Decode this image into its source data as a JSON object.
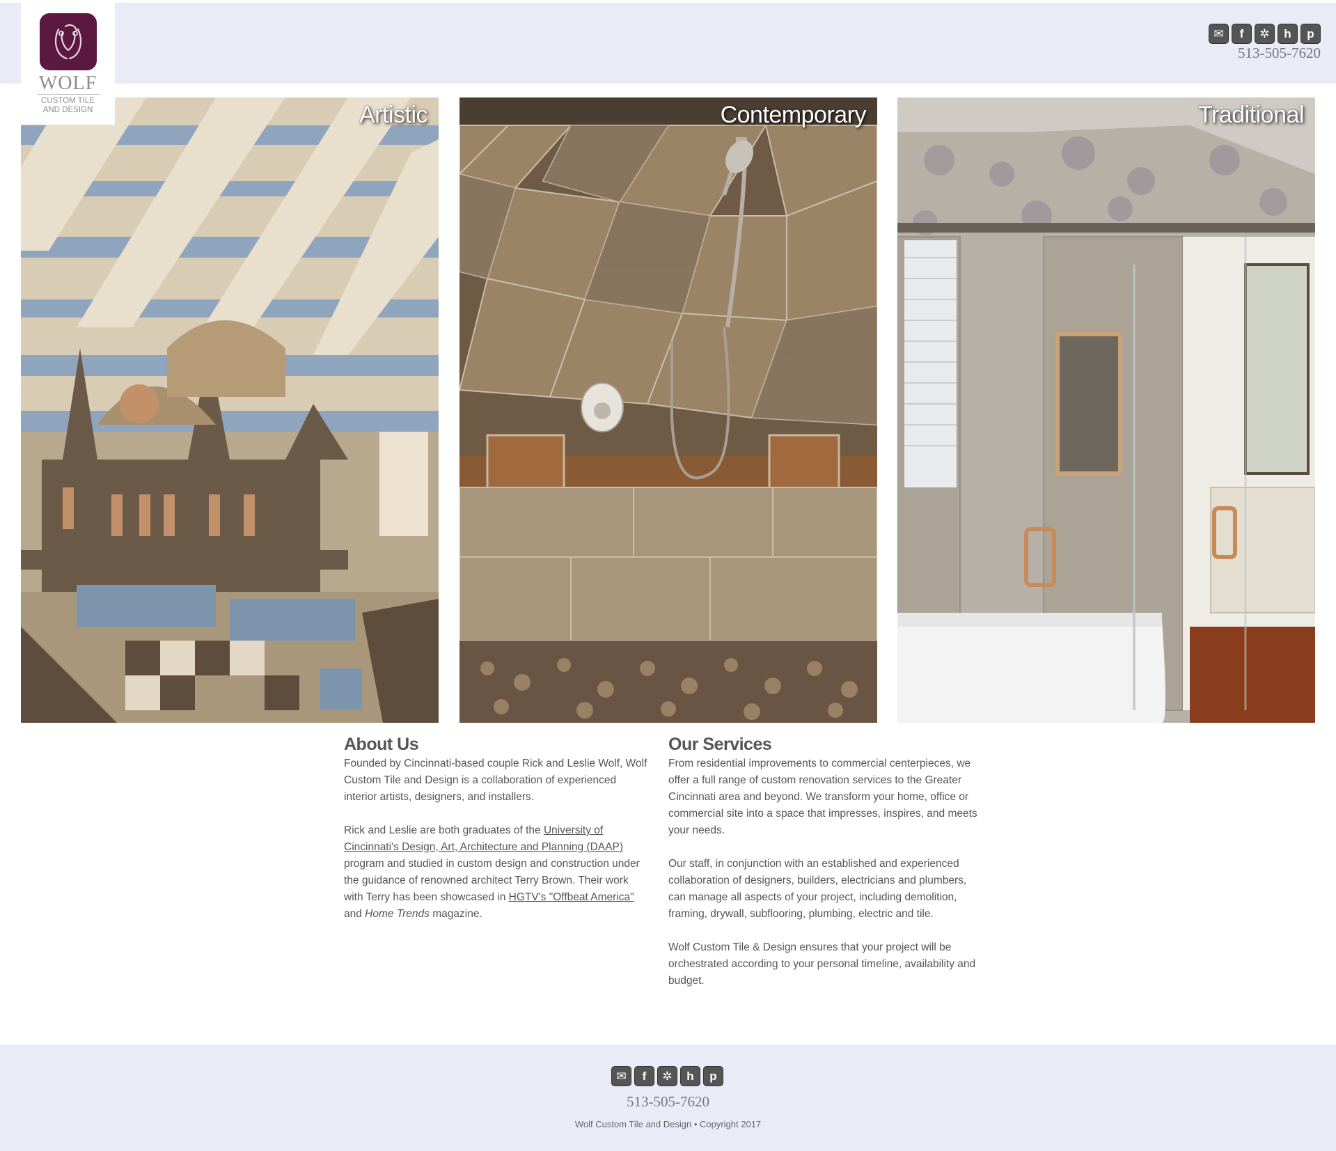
{
  "header": {
    "logo": {
      "word": "WOLF",
      "sub": "CUSTOM TILE AND DESIGN"
    },
    "phone": "513-505-7620",
    "social": [
      {
        "icon": "email-icon",
        "glyph": "✉"
      },
      {
        "icon": "facebook-icon",
        "glyph": "f"
      },
      {
        "icon": "yelp-icon",
        "glyph": "✲"
      },
      {
        "icon": "houzz-icon",
        "glyph": "h"
      },
      {
        "icon": "pinterest-icon",
        "glyph": "p"
      }
    ]
  },
  "panels": [
    {
      "title": "Artistic"
    },
    {
      "title": "Contemporary"
    },
    {
      "title": "Traditional"
    }
  ],
  "about": {
    "heading": "About Us",
    "p1": "Founded by Cincinnati-based couple Rick and Leslie Wolf, Wolf Custom Tile and Design is a collaboration of experienced interior artists, designers, and installers.",
    "p2_start": "Rick and Leslie are both graduates of the ",
    "p2_link": "University of Cincinnati's Design, Art, Architecture and Planning (DAAP)",
    "p2_mid": " program and studied in custom design and construction under the guidance of renowned architect Terry Brown. Their work with Terry has been showcased in ",
    "p2_link2": "HGTV's \"Offbeat America\"",
    "p2_and": " and ",
    "p2_em": "Home Trends",
    "p2_end": " magazine."
  },
  "services": {
    "heading": "Our Services",
    "p1": "From residential improvements to commercial centerpieces, we offer a full range of custom renovation services to the Greater Cincinnati area and beyond. We transform your home, office or commercial site into a space that impresses, inspires, and meets your needs.",
    "p2": "Our staff, in conjunction with an established and experienced collaboration of designers, builders, electricians and plumbers, can manage all aspects of your project, including demolition, framing, drywall, subflooring, plumbing, electric and tile.",
    "p3": "Wolf Custom Tile & Design ensures that your project will be orchestrated according to your personal timeline, availability and budget."
  },
  "footer": {
    "phone": "513-505-7620",
    "copyright": "Wolf Custom Tile and Design • Copyright 2017"
  }
}
